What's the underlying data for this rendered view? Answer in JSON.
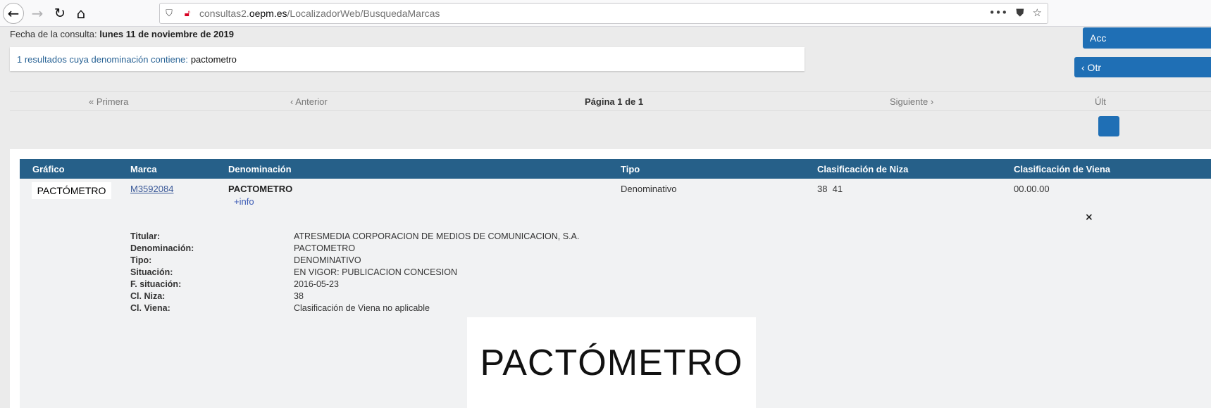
{
  "browser": {
    "url_prefix": "consultas2.",
    "url_domain": "oepm.es",
    "url_path": "/LocalizadorWeb/BusquedaMarcas",
    "more_label": "•••"
  },
  "header": {
    "fecha_label": "Fecha de la consulta:",
    "fecha_value": "lunes 11 de noviembre de 2019"
  },
  "results": {
    "summary": "1 resultados cuya denominación contiene:",
    "term": "pactometro"
  },
  "side_buttons": {
    "top": "Acc",
    "second": "‹ Otr"
  },
  "pager": {
    "first": "« Primera",
    "prev": "‹ Anterior",
    "current": "Página 1 de 1",
    "next": "Siguiente ›",
    "last": "Últ"
  },
  "table": {
    "headers": [
      "Gráfico",
      "Marca",
      "Denominación",
      "Tipo",
      "Clasificación de Niza",
      "Clasificación de Viena"
    ],
    "row": {
      "grafico": "PACTÓMETRO",
      "marca": "M3592084",
      "denominacion": "PACTOMETRO",
      "info_link": "+info",
      "tipo": "Denominativo",
      "niza": "38  41",
      "viena": "00.00.00"
    }
  },
  "details": [
    {
      "key": "Titular:",
      "value": "ATRESMEDIA CORPORACION DE MEDIOS DE COMUNICACION, S.A."
    },
    {
      "key": "Denominación:",
      "value": "PACTOMETRO"
    },
    {
      "key": "Tipo:",
      "value": "DENOMINATIVO"
    },
    {
      "key": "Situación:",
      "value": "EN VIGOR: PUBLICACION CONCESION"
    },
    {
      "key": "F. situación:",
      "value": "2016-05-23"
    },
    {
      "key": "Cl. Niza:",
      "value": "38"
    },
    {
      "key": "Cl. Viena:",
      "value": "Clasificación de Viena no aplicable"
    }
  ],
  "logo_large_text": "PACTÓMETRO",
  "close_symbol": "×"
}
